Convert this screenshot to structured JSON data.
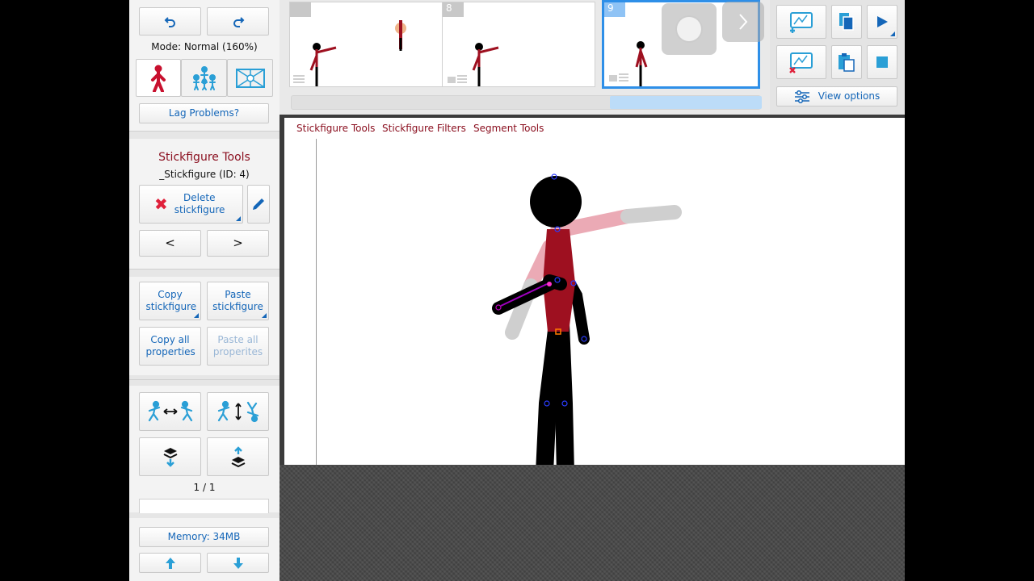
{
  "left_panel": {
    "mode_text": "Mode: Normal (160%)",
    "lag_button": "Lag Problems?",
    "section_title": "Stickfigure Tools",
    "figure_name": "_Stickfigure (ID: 4)",
    "delete_button": "Delete stickfigure",
    "prev_label": "<",
    "next_label": ">",
    "copy_button": "Copy stickfigure",
    "paste_button": "Paste stickfigure",
    "copy_all_button": "Copy all properties",
    "paste_all_button": "Paste all properites",
    "page_counter": "1 / 1",
    "memory_button": "Memory: 34MB"
  },
  "timeline": {
    "frames": [
      {
        "number": ""
      },
      {
        "number": "8"
      },
      {
        "number": "9"
      }
    ]
  },
  "tools": {
    "view_options": "View options"
  },
  "canvas_menu": {
    "items": [
      "Stickfigure Tools",
      "Stickfigure Filters",
      "Segment Tools"
    ]
  },
  "colors": {
    "accent_blue": "#1466b8",
    "tool_red": "#8b1020",
    "figure_red": "#9e1020",
    "selection_blue": "#2e8fe8"
  }
}
